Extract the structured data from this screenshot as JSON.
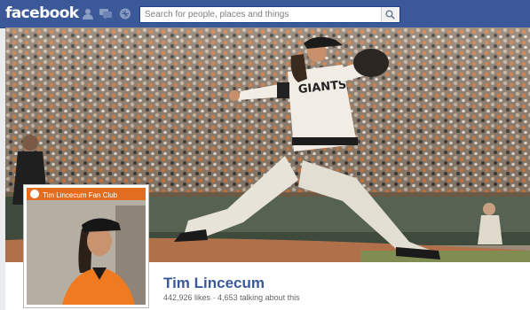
{
  "header": {
    "logo_text": "facebook",
    "search": {
      "placeholder": "Search for people, places and things",
      "value": ""
    },
    "jewels": [
      {
        "icon": "friend-requests-icon"
      },
      {
        "icon": "messages-icon"
      },
      {
        "icon": "notifications-icon"
      }
    ],
    "colors": {
      "bar": "#3b5998",
      "accent": "#3b5998"
    }
  },
  "profile": {
    "name": "Tim Lincecum",
    "likes": "442,926 likes",
    "separator": "·",
    "talking": "4,653 talking about this",
    "pic_banner_text": "Tim Lincecum Fan Club"
  },
  "cover": {
    "jersey_text": "GIANTS"
  }
}
